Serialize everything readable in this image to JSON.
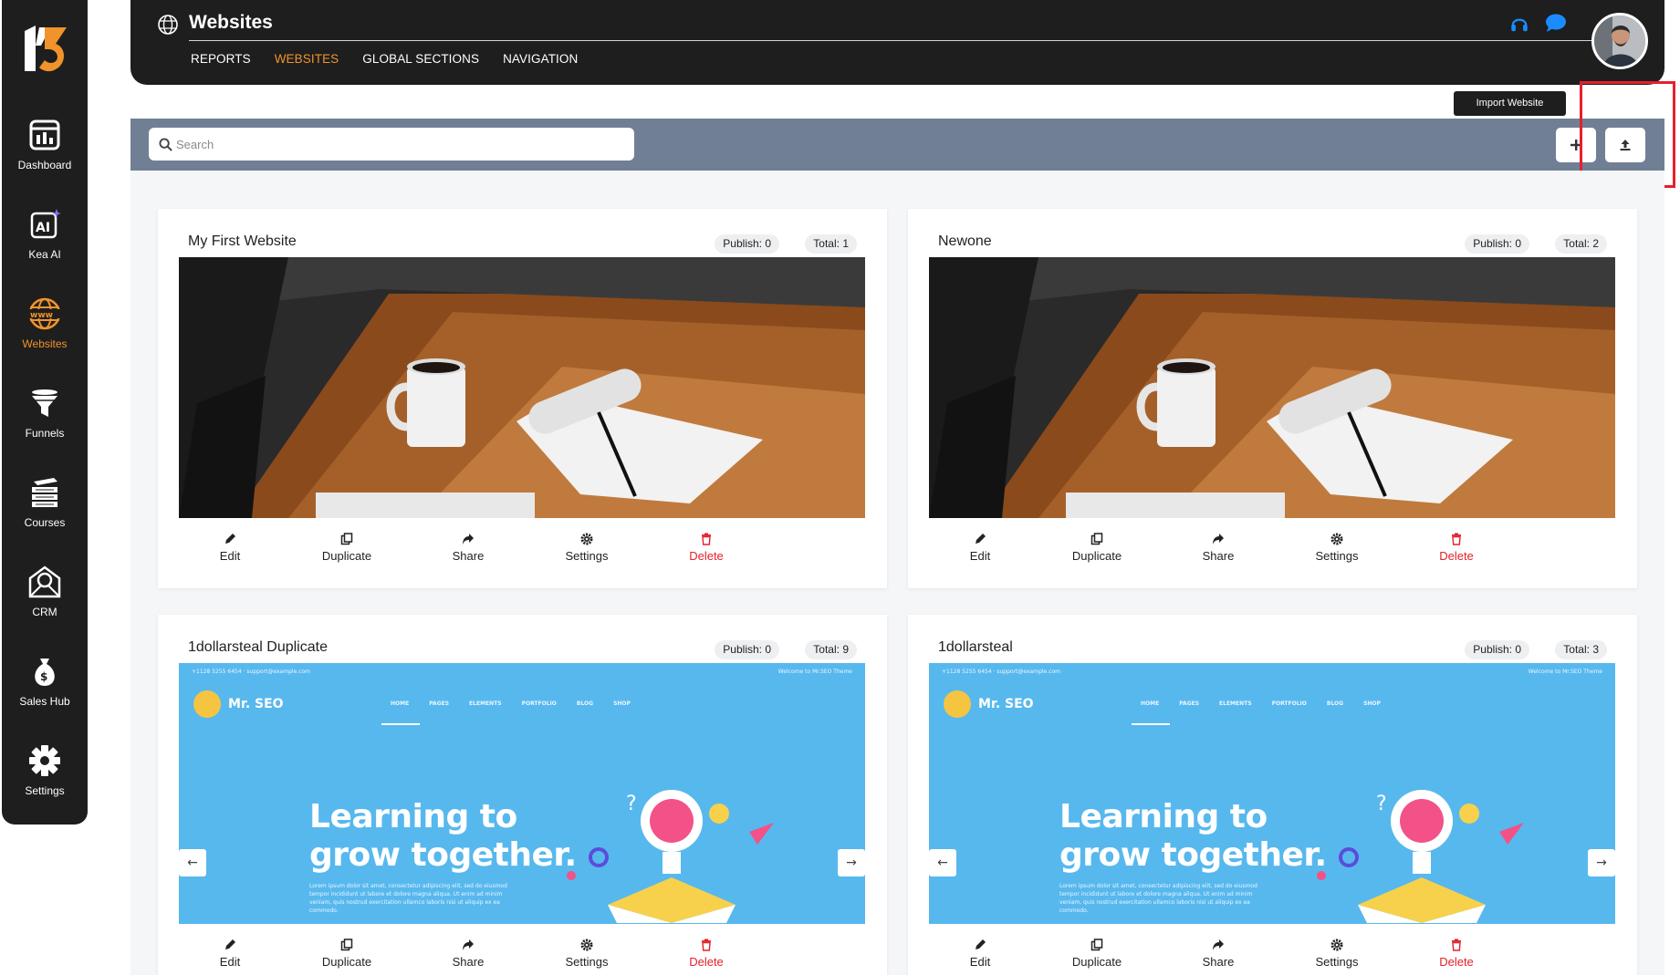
{
  "sidebar": {
    "items": [
      {
        "label": "Dashboard",
        "icon": "dashboard-icon",
        "active": false
      },
      {
        "label": "Kea AI",
        "icon": "ai-icon",
        "active": false
      },
      {
        "label": "Websites",
        "icon": "www-globe-icon",
        "active": true
      },
      {
        "label": "Funnels",
        "icon": "funnel-icon",
        "active": false
      },
      {
        "label": "Courses",
        "icon": "courses-icon",
        "active": false
      },
      {
        "label": "CRM",
        "icon": "crm-icon",
        "active": false
      },
      {
        "label": "Sales Hub",
        "icon": "money-bag-icon",
        "active": false
      },
      {
        "label": "Settings",
        "icon": "gear-icon",
        "active": false
      }
    ]
  },
  "header": {
    "title": "Websites",
    "tabs": [
      {
        "label": "REPORTS",
        "active": false
      },
      {
        "label": "WEBSITES",
        "active": true
      },
      {
        "label": "GLOBAL SECTIONS",
        "active": false
      },
      {
        "label": "NAVIGATION",
        "active": false
      }
    ]
  },
  "toolbar": {
    "search_placeholder": "Search",
    "tooltip": "Import Website"
  },
  "actions": {
    "edit": "Edit",
    "duplicate": "Duplicate",
    "share": "Share",
    "settings": "Settings",
    "delete": "Delete"
  },
  "websites": [
    {
      "title": "My First Website",
      "publish": "Publish: 0",
      "total": "Total: 1",
      "thumbnail": "desk-photo"
    },
    {
      "title": "Newone",
      "publish": "Publish: 0",
      "total": "Total: 2",
      "thumbnail": "desk-photo"
    },
    {
      "title": "1dollarsteal Duplicate",
      "publish": "Publish: 0",
      "total": "Total: 9",
      "thumbnail": "seo-theme"
    },
    {
      "title": "1dollarsteal",
      "publish": "Publish: 0",
      "total": "Total: 3",
      "thumbnail": "seo-theme"
    }
  ],
  "seo_theme": {
    "topbar": "+1128 5255 6454 · support@example.com",
    "welcome": "Welcome to Mr.SEO Theme",
    "brand": "Mr. SEO",
    "menu": [
      "HOME",
      "PAGES",
      "ELEMENTS",
      "PORTFOLIO",
      "BLOG",
      "SHOP"
    ],
    "headline_1": "Learning to",
    "headline_2": "grow together.",
    "lorem": "Lorem ipsum dolor sit amet, consectetur adipiscing elit, sed do eiusmod tempor incididunt ut labore et dolore magna aliqua. Ut enim ad minim veniam, quis nostrud exercitation ullamco laboris nisi ut aliquip ex ea commodo."
  },
  "colors": {
    "accent": "#f0932b",
    "danger": "#e5202b",
    "dark": "#1e1e1e",
    "toolbar": "#717f95",
    "chat": "#1a8cff",
    "seo_blue": "#57b8ee"
  }
}
